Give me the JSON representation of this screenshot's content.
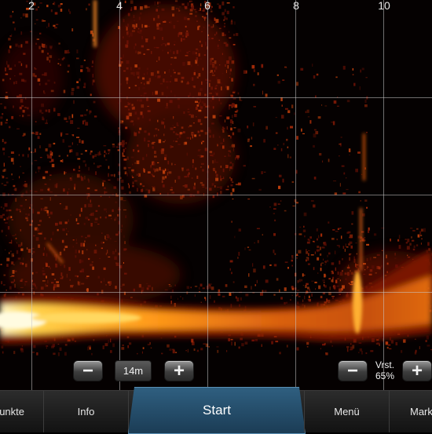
{
  "sonar": {
    "distance_ticks": [
      "2",
      "4",
      "6",
      "8",
      "10"
    ]
  },
  "controls": {
    "zoom_out_symbol": "−",
    "range_value": "14m",
    "zoom_in_symbol": "+",
    "gain_decrease_symbol": "−",
    "gain_label": "Vrst.",
    "gain_value": "65%",
    "gain_increase_symbol": "+"
  },
  "tabs": {
    "waypoints_label": "unkte",
    "info_label": "Info",
    "start_label": "Start",
    "menu_label": "Menü",
    "mark_label": "Mark"
  },
  "colors": {
    "echo_strong": "#fff3b0",
    "echo_mid": "#ff9a1a",
    "echo_weak": "#8a1a05",
    "start_tab": "#26506d"
  }
}
